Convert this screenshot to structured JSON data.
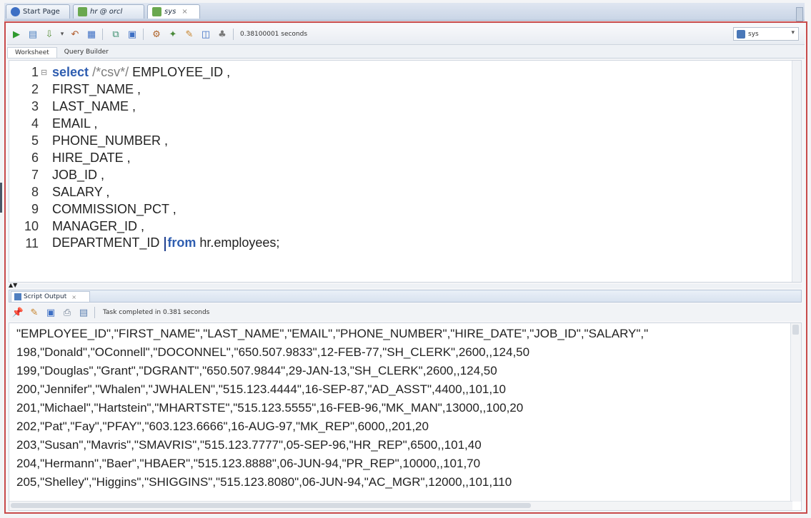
{
  "doc_tabs": [
    {
      "label": "Start Page",
      "icon": "question-circle-icon",
      "active": false
    },
    {
      "label": "hr @ orcl",
      "icon": "db-connection-icon",
      "active": false
    },
    {
      "label": "sys",
      "icon": "db-connection-icon",
      "active": true
    }
  ],
  "toolbar": {
    "timing": "0.38100001 seconds",
    "connection": "sys"
  },
  "subtabs": [
    "Worksheet",
    "Query Builder"
  ],
  "editor": {
    "lines": [
      {
        "num": "1",
        "kw": "select",
        "comment": "/*csv*/",
        "text": " EMPLOYEE_ID ,"
      },
      {
        "num": "2",
        "text": "FIRST_NAME ,"
      },
      {
        "num": "3",
        "text": "LAST_NAME ,"
      },
      {
        "num": "4",
        "text": "EMAIL ,"
      },
      {
        "num": "5",
        "text": "PHONE_NUMBER ,"
      },
      {
        "num": "6",
        "text": "HIRE_DATE ,"
      },
      {
        "num": "7",
        "text": "JOB_ID ,"
      },
      {
        "num": "8",
        "text": "SALARY ,"
      },
      {
        "num": "9",
        "text": "COMMISSION_PCT ,"
      },
      {
        "num": "10",
        "text": "MANAGER_ID ,"
      },
      {
        "num": "11",
        "text": "DEPARTMENT_ID ",
        "kw2": "from",
        "tail": " hr.employees;"
      }
    ]
  },
  "output": {
    "tab_label": "Script Output",
    "status": "Task completed in 0.381 seconds",
    "rows": [
      "\"EMPLOYEE_ID\",\"FIRST_NAME\",\"LAST_NAME\",\"EMAIL\",\"PHONE_NUMBER\",\"HIRE_DATE\",\"JOB_ID\",\"SALARY\",\"",
      "198,\"Donald\",\"OConnell\",\"DOCONNEL\",\"650.507.9833\",12-FEB-77,\"SH_CLERK\",2600,,124,50",
      "199,\"Douglas\",\"Grant\",\"DGRANT\",\"650.507.9844\",29-JAN-13,\"SH_CLERK\",2600,,124,50",
      "200,\"Jennifer\",\"Whalen\",\"JWHALEN\",\"515.123.4444\",16-SEP-87,\"AD_ASST\",4400,,101,10",
      "201,\"Michael\",\"Hartstein\",\"MHARTSTE\",\"515.123.5555\",16-FEB-96,\"MK_MAN\",13000,,100,20",
      "202,\"Pat\",\"Fay\",\"PFAY\",\"603.123.6666\",16-AUG-97,\"MK_REP\",6000,,201,20",
      "203,\"Susan\",\"Mavris\",\"SMAVRIS\",\"515.123.7777\",05-SEP-96,\"HR_REP\",6500,,101,40",
      "204,\"Hermann\",\"Baer\",\"HBAER\",\"515.123.8888\",06-JUN-94,\"PR_REP\",10000,,101,70",
      "205,\"Shelley\",\"Higgins\",\"SHIGGINS\",\"515.123.8080\",06-JUN-94,\"AC_MGR\",12000,,101,110"
    ]
  },
  "colors": {
    "keyword": "#2e5db0",
    "comment": "#7d7d7d",
    "panel_border": "#c84a4a"
  }
}
